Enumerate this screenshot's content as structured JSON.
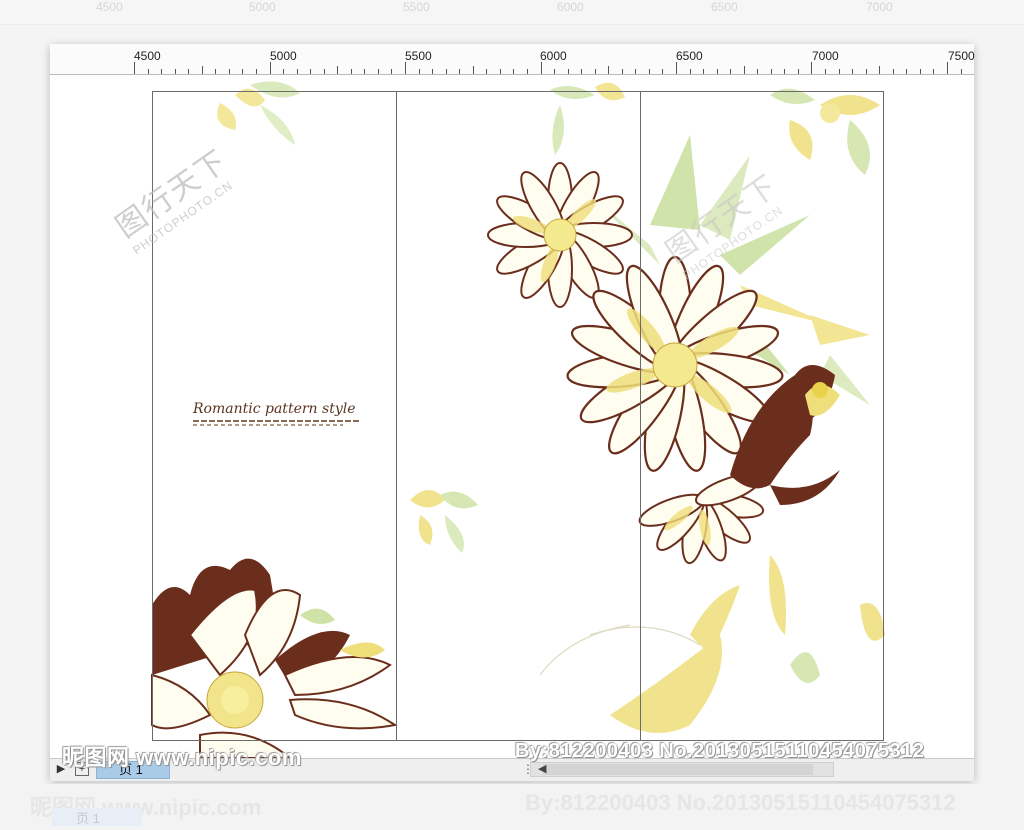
{
  "bg_ruler": {
    "labels": [
      "4500",
      "5000",
      "5500",
      "6000",
      "6500",
      "7000"
    ]
  },
  "ruler": {
    "labels": [
      "4500",
      "5000",
      "5500",
      "6000",
      "6500",
      "7000",
      "7500"
    ]
  },
  "design": {
    "tagline": "Romantic pattern style",
    "watermark_cn": "图行天下",
    "watermark_en": "PHOTOPHOTO.CN"
  },
  "colors": {
    "brown": "#6b2e1c",
    "yellow": "#efdf7a",
    "green": "#b9d98a",
    "frame": "#6b6b6b"
  },
  "statusbar": {
    "page_tab": "页 1",
    "add_page_icon": "add-page-icon",
    "nav_icon": "play-left-icon"
  },
  "site_watermark": {
    "left": "昵图网 www.nipic.com",
    "right": "By:812200403 No.20130515110454075312"
  }
}
